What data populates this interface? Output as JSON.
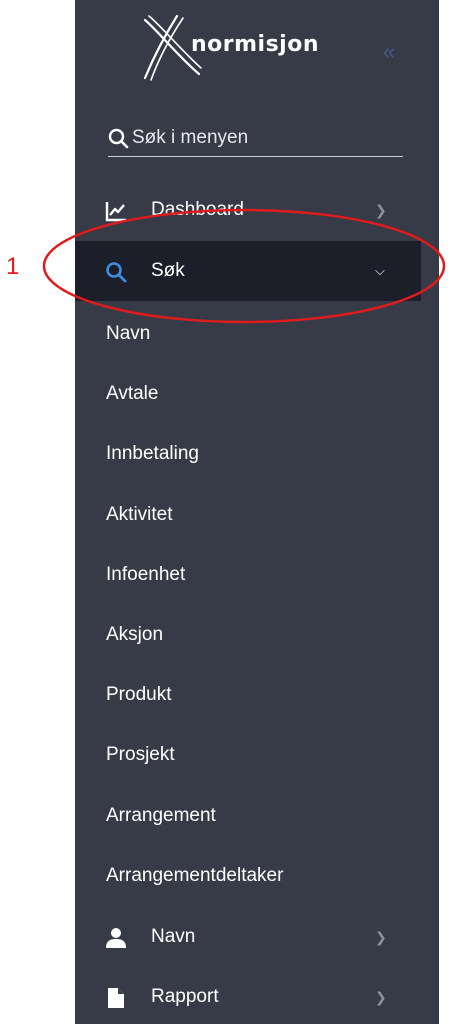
{
  "brand": {
    "name": "normisjon"
  },
  "sidebar": {
    "collapse_glyph": "«",
    "search": {
      "placeholder": "Søk i menyen",
      "value": ""
    },
    "items": [
      {
        "label": "Dashboard",
        "icon": "chart-line-icon",
        "expanded": false
      },
      {
        "label": "Søk",
        "icon": "search-icon",
        "expanded": true,
        "active": true
      },
      {
        "label": "Navn",
        "icon": "user-icon",
        "expanded": false
      },
      {
        "label": "Rapport",
        "icon": "file-icon",
        "expanded": false
      }
    ],
    "sok_subitems": [
      "Navn",
      "Avtale",
      "Innbetaling",
      "Aktivitet",
      "Infoenhet",
      "Aksjon",
      "Produkt",
      "Prosjekt",
      "Arrangement",
      "Arrangementdeltaker"
    ]
  },
  "annotation": {
    "number": "1",
    "color": "#e01b1b"
  },
  "colors": {
    "sidebar_bg": "#363b47",
    "active_bg": "#1c1f2a",
    "search_icon_active": "#3d8de0",
    "collapse_icon": "#4a5785"
  }
}
